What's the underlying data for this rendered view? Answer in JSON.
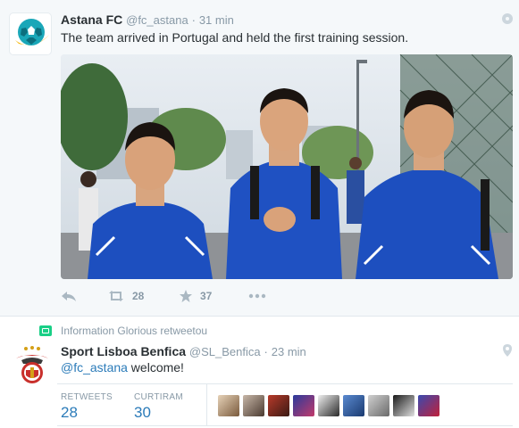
{
  "tweet1": {
    "fullname": "Astana FC",
    "handle": "@fc_astana",
    "separator": "·",
    "time": "31 min",
    "text": "The team arrived in Portugal and held the first training session.",
    "actions": {
      "retweet_count": "28",
      "favorite_count": "37"
    }
  },
  "retweet_context": {
    "text": "Information Glorious retweetou"
  },
  "tweet2": {
    "fullname": "Sport Lisboa Benfica",
    "handle": "@SL_Benfica",
    "separator": "·",
    "time": "23 min",
    "mention": "@fc_astana",
    "text": " welcome!",
    "stats": {
      "retweets_label": "RETWEETS",
      "retweets_value": "28",
      "likes_label": "CURTIRAM",
      "likes_value": "30"
    }
  },
  "colors": {
    "link": "#2b7bb9",
    "muted": "#8899a6",
    "retweet_green": "#19cf86",
    "kit_blue": "#1d4fbf"
  },
  "icons": [
    "gear-icon",
    "reply-icon",
    "retweet-icon",
    "star-icon",
    "more-icon",
    "location-pin-icon",
    "retweet-badge-icon"
  ]
}
